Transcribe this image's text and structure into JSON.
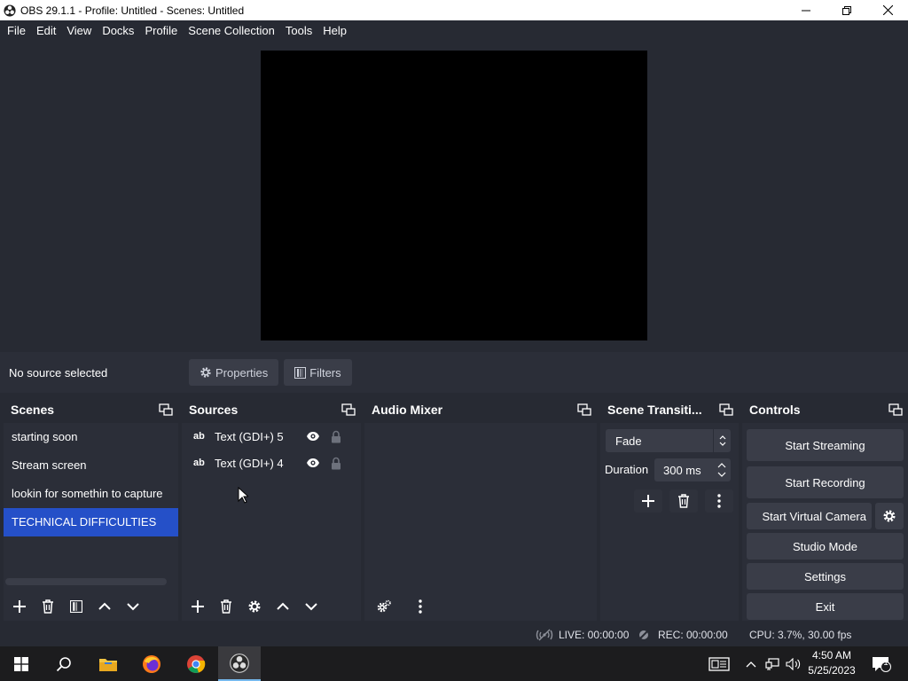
{
  "window": {
    "title": "OBS 29.1.1 - Profile: Untitled - Scenes: Untitled"
  },
  "menu": [
    "File",
    "Edit",
    "View",
    "Docks",
    "Profile",
    "Scene Collection",
    "Tools",
    "Help"
  ],
  "source_toolbar": {
    "status": "No source selected",
    "properties_label": "Properties",
    "filters_label": "Filters"
  },
  "docks": {
    "scenes": {
      "title": "Scenes",
      "items": [
        "starting soon",
        "Stream screen",
        "lookin for somethin to capture",
        "TECHNICAL DIFFICULTIES"
      ],
      "selected": "TECHNICAL DIFFICULTIES"
    },
    "sources": {
      "title": "Sources",
      "type_badge": "ab",
      "items": [
        "Text (GDI+) 5",
        "Text (GDI+) 4"
      ]
    },
    "mixer": {
      "title": "Audio Mixer"
    },
    "transitions": {
      "title": "Scene Transiti...",
      "selected_transition": "Fade",
      "duration_label": "Duration",
      "duration_value": "300 ms"
    },
    "controls": {
      "title": "Controls",
      "start_streaming": "Start Streaming",
      "start_recording": "Start Recording",
      "start_virtual_camera": "Start Virtual Camera",
      "studio_mode": "Studio Mode",
      "settings": "Settings",
      "exit": "Exit"
    }
  },
  "status": {
    "live": "LIVE: 00:00:00",
    "rec": "REC: 00:00:00",
    "cpu": "CPU: 3.7%, 30.00 fps"
  },
  "taskbar": {
    "time": "4:50 AM",
    "date": "5/25/2023",
    "notifications": "1"
  },
  "colors": {
    "background": "#272a33",
    "panel": "#2b2e38",
    "button": "#3a3d48",
    "selection": "#2550c8",
    "preview": "#000000"
  }
}
